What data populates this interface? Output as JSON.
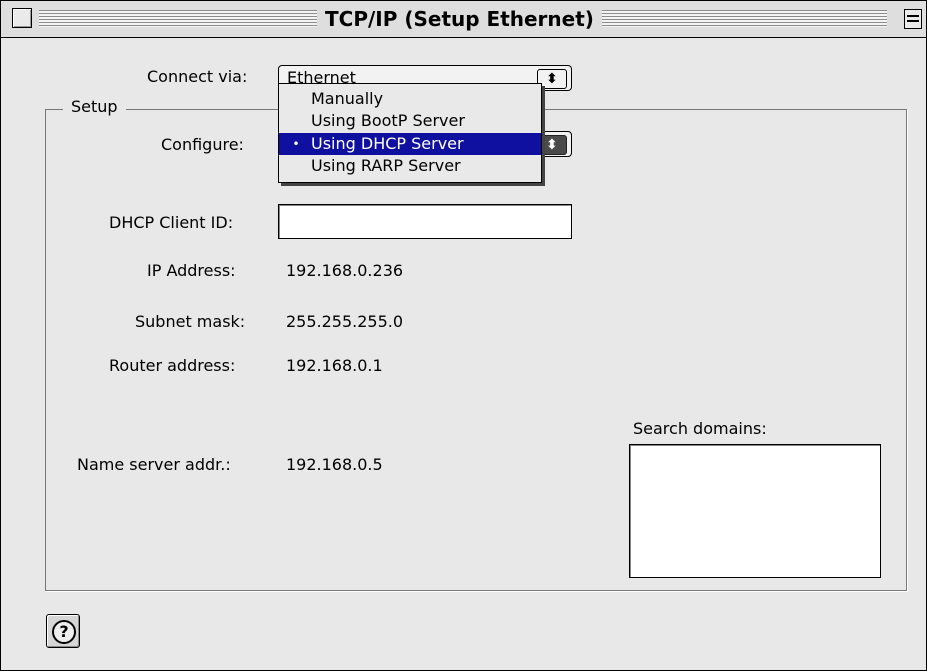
{
  "window": {
    "title": "TCP/IP (Setup Ethernet)"
  },
  "connect": {
    "label": "Connect via:",
    "value": "Ethernet"
  },
  "setup": {
    "label": "Setup"
  },
  "configure": {
    "label": "Configure:",
    "menu_items": [
      {
        "label": "Manually",
        "selected": false
      },
      {
        "label": "Using BootP Server",
        "selected": false
      },
      {
        "label": "Using DHCP Server",
        "selected": true
      },
      {
        "label": "Using RARP Server",
        "selected": false
      }
    ],
    "selected_bullet": "•"
  },
  "dhcp": {
    "label": "DHCP Client ID:",
    "value": ""
  },
  "ip": {
    "label": "IP Address:",
    "value": "192.168.0.236"
  },
  "subnet": {
    "label": "Subnet mask:",
    "value": "255.255.255.0"
  },
  "router": {
    "label": "Router address:",
    "value": "192.168.0.1"
  },
  "nameserver": {
    "label": "Name server addr.:",
    "value": "192.168.0.5"
  },
  "search": {
    "label": "Search domains:",
    "value": ""
  },
  "icons": {
    "help": "?",
    "popup_arrows": "⬍"
  }
}
